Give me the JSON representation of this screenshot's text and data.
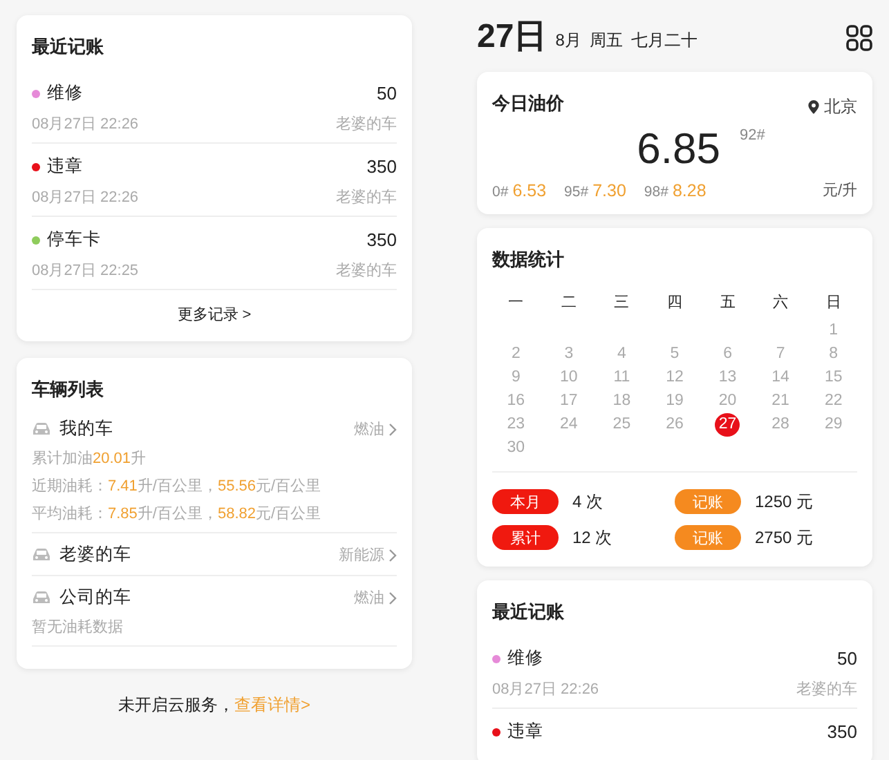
{
  "left": {
    "records": {
      "title": "最近记账",
      "items": [
        {
          "name": "维修",
          "color": "#e68ad8",
          "amount": "50",
          "time": "08月27日 22:26",
          "vehicle": "老婆的车"
        },
        {
          "name": "违章",
          "color": "#e8101a",
          "amount": "350",
          "time": "08月27日 22:26",
          "vehicle": "老婆的车"
        },
        {
          "name": "停车卡",
          "color": "#8fcc5c",
          "amount": "350",
          "time": "08月27日 22:25",
          "vehicle": "老婆的车"
        }
      ],
      "more": "更多记录 >"
    },
    "vehicles": {
      "title": "车辆列表",
      "items": [
        {
          "name": "我的车",
          "type": "燃油",
          "lines": [
            [
              {
                "text": "累计加油",
                "accent": false
              },
              {
                "text": "20.01",
                "accent": true
              },
              {
                "text": "升",
                "accent": false
              }
            ],
            [
              {
                "text": "近期油耗：",
                "accent": false
              },
              {
                "text": "7.41",
                "accent": true
              },
              {
                "text": "升/百公里，",
                "accent": false
              },
              {
                "text": "55.56",
                "accent": true
              },
              {
                "text": "元/百公里",
                "accent": false
              }
            ],
            [
              {
                "text": "平均油耗：",
                "accent": false
              },
              {
                "text": "7.85",
                "accent": true
              },
              {
                "text": "升/百公里，",
                "accent": false
              },
              {
                "text": "58.82",
                "accent": true
              },
              {
                "text": "元/百公里",
                "accent": false
              }
            ]
          ]
        },
        {
          "name": "老婆的车",
          "type": "新能源"
        },
        {
          "name": "公司的车",
          "type": "燃油",
          "lines": [
            [
              {
                "text": "暂无油耗数据",
                "accent": false
              }
            ]
          ]
        }
      ]
    },
    "footer": {
      "text": "未开启云服务，",
      "link": "查看详情>"
    }
  },
  "right": {
    "date": {
      "day": "27日",
      "month": "8月",
      "weekday": "周五",
      "lunar": "七月二十"
    },
    "oil": {
      "title": "今日油价",
      "location": "北京",
      "price": "6.85",
      "grade": "92#",
      "others": [
        {
          "grade": "0#",
          "price": "6.53"
        },
        {
          "grade": "95#",
          "price": "7.30"
        },
        {
          "grade": "98#",
          "price": "8.28"
        }
      ],
      "unit": "元/升"
    },
    "stats": {
      "title": "数据统计",
      "weekdays": [
        "一",
        "二",
        "三",
        "四",
        "五",
        "六",
        "日"
      ],
      "weeks": [
        [
          {
            "day": "1",
            "selected": false
          }
        ],
        [
          {
            "day": "2",
            "selected": false
          },
          {
            "day": "3",
            "selected": false
          },
          {
            "day": "4",
            "selected": false
          },
          {
            "day": "5",
            "selected": false
          },
          {
            "day": "6",
            "selected": false
          },
          {
            "day": "7",
            "selected": false
          },
          {
            "day": "8",
            "selected": false
          }
        ],
        [
          {
            "day": "9",
            "selected": false
          },
          {
            "day": "10",
            "selected": false
          },
          {
            "day": "11",
            "selected": false
          },
          {
            "day": "12",
            "selected": false
          },
          {
            "day": "13",
            "selected": false
          },
          {
            "day": "14",
            "selected": false
          },
          {
            "day": "15",
            "selected": false
          }
        ],
        [
          {
            "day": "16",
            "selected": false
          },
          {
            "day": "17",
            "selected": false
          },
          {
            "day": "18",
            "selected": false
          },
          {
            "day": "19",
            "selected": false
          },
          {
            "day": "20",
            "selected": false
          },
          {
            "day": "21",
            "selected": false
          },
          {
            "day": "22",
            "selected": false
          }
        ],
        [
          {
            "day": "23",
            "selected": false
          },
          {
            "day": "24",
            "selected": false
          },
          {
            "day": "25",
            "selected": false
          },
          {
            "day": "26",
            "selected": false
          },
          {
            "day": "27",
            "selected": true
          },
          {
            "day": "28",
            "selected": false
          },
          {
            "day": "29",
            "selected": false
          }
        ],
        [
          {
            "day": "30",
            "selected": false
          }
        ]
      ],
      "summary": [
        {
          "label": "本月",
          "color": "#f0190f",
          "value": "4 次"
        },
        {
          "label": "记账",
          "color": "#f58a1f",
          "value": "1250 元"
        },
        {
          "label": "累计",
          "color": "#f0190f",
          "value": "12 次"
        },
        {
          "label": "记账",
          "color": "#f58a1f",
          "value": "2750 元"
        }
      ]
    },
    "records": {
      "title": "最近记账",
      "items": [
        {
          "name": "维修",
          "color": "#e68ad8",
          "amount": "50",
          "time": "08月27日 22:26",
          "vehicle": "老婆的车"
        },
        {
          "name": "违章",
          "color": "#e8101a",
          "amount": "350"
        }
      ]
    }
  }
}
